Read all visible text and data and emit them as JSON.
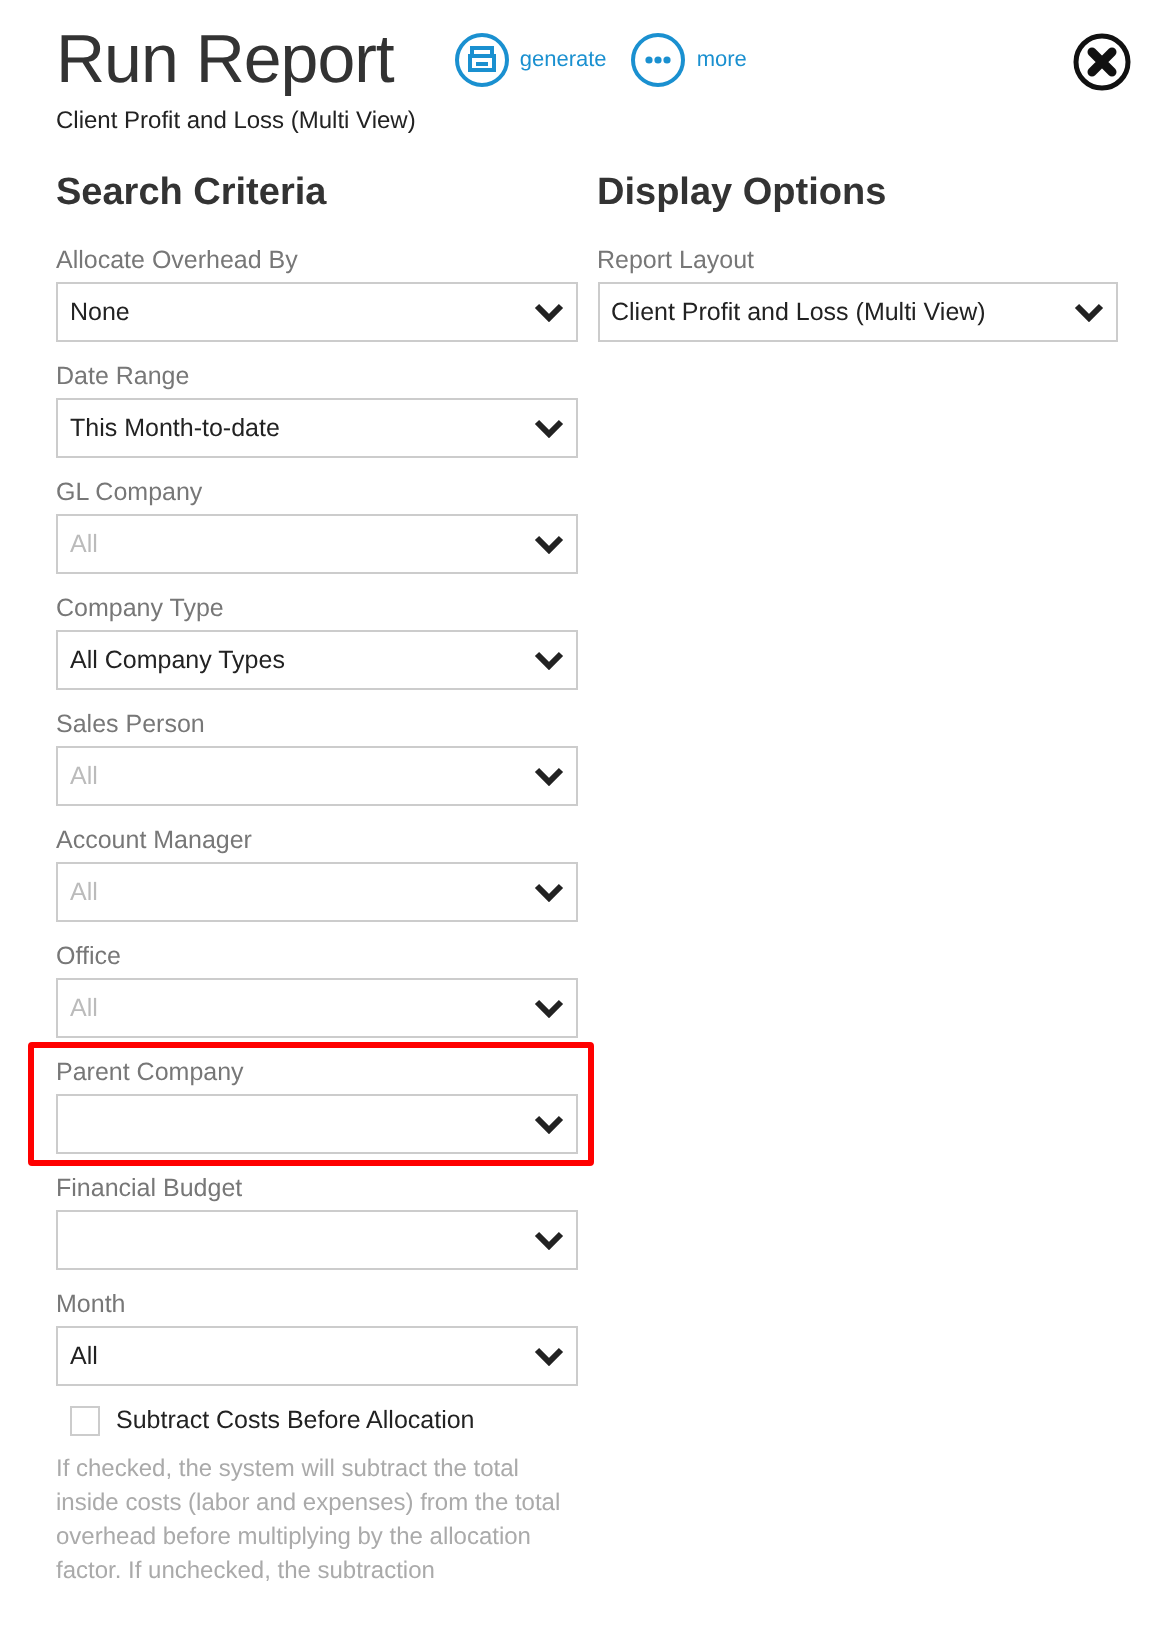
{
  "header": {
    "title": "Run Report",
    "subtitle": "Client Profit and Loss (Multi View)",
    "actions": [
      {
        "kind": "print",
        "label": "generate"
      },
      {
        "kind": "more",
        "label": "more"
      }
    ]
  },
  "search_criteria": {
    "heading": "Search Criteria",
    "fields": [
      {
        "label": "Allocate Overhead By",
        "value": "None",
        "highlighted": false
      },
      {
        "label": "Date Range",
        "value": "This Month-to-date",
        "highlighted": false
      },
      {
        "label": "GL Company",
        "placeholder": "All",
        "highlighted": false
      },
      {
        "label": "Company Type",
        "value": "All Company Types",
        "highlighted": false
      },
      {
        "label": "Sales Person",
        "placeholder": "All",
        "highlighted": false
      },
      {
        "label": "Account Manager",
        "placeholder": "All",
        "highlighted": false
      },
      {
        "label": "Office",
        "placeholder": "All",
        "highlighted": false
      },
      {
        "label": "Parent Company",
        "highlighted": true
      },
      {
        "label": "Financial Budget",
        "highlighted": false
      },
      {
        "label": "Month",
        "value": "All",
        "highlighted": false
      }
    ],
    "checkbox": {
      "label": "Subtract Costs Before Allocation",
      "checked": false
    },
    "help": "If checked, the system will subtract the total inside costs (labor and expenses) from the total overhead before multiplying by the allocation factor. If unchecked, the subtraction"
  },
  "display_options": {
    "heading": "Display Options",
    "fields": [
      {
        "label": "Report Layout",
        "value": "Client Profit and Loss (Multi View)",
        "highlighted": false
      }
    ]
  }
}
